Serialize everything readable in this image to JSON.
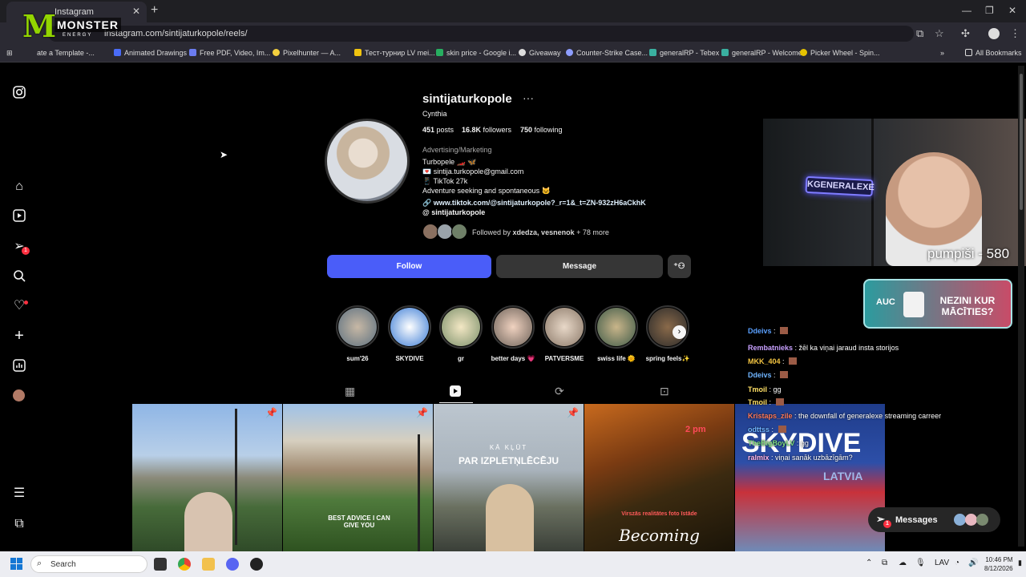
{
  "browser": {
    "tab_title": "Instagram",
    "url": "instagram.com/sintijaturkopole/reels/",
    "bookmarks": [
      "ate a Template -...",
      "Animated Drawings",
      "Free PDF, Video, Im...",
      "Pixelhunter — A...",
      "Тест-турнир LV mei...",
      "skin price - Google i...",
      "Giveaway",
      "Counter-Strike Case...",
      "generalRP - Tebex",
      "generalRP - Welcome",
      "Picker Wheel - Spin..."
    ],
    "all_bookmarks": "All Bookmarks"
  },
  "overlay": {
    "monster_word": "MONSTER",
    "monster_sub": "ENERGY",
    "neon_sign": "KGENERALEXE",
    "webcam_text": "pumpiši - 580",
    "promo_left": "AUC",
    "promo_right": "NEZINI KUR MĀCĪTIES?"
  },
  "profile": {
    "username": "sintijaturkopole",
    "display_name": "Cynthia",
    "posts_count": "451",
    "posts_label": "posts",
    "followers_count": "16.8K",
    "followers_label": "followers",
    "following_count": "750",
    "following_label": "following",
    "category": "Advertising/Marketing",
    "bio_lines": [
      "Turbopele 🏎️ 🦋",
      "💌 sintija.turkopole@gmail.com",
      "📱 TikTok 27k",
      "Adventure seeking and spontaneous 🐱"
    ],
    "link": "www.tiktok.com/@sintijaturkopole?_r=1&_t=ZN-932zH6aCkhK",
    "threads_handle": "sintijaturkopole",
    "followed_by_prefix": "Followed by",
    "followed_by_names": "xdedza, vesnenok",
    "followed_by_more": "+ 78 more",
    "follow_label": "Follow",
    "message_label": "Message"
  },
  "highlights": [
    "sum'26",
    "SKYDIVE",
    "gr",
    "better days 💗",
    "PATVERSME",
    "swiss life 🌞",
    "spring feels✨"
  ],
  "reels": {
    "reel3_small": "KĀ KĻŪT",
    "reel3_big": "PAR IZPLETŅLĒCĒJU",
    "reel2_text": "BEST ADVICE I CAN GIVE YOU",
    "reel4_top": "2 pm",
    "reel4_small": "Virszās realitātes foto īstāde",
    "reel4_big": "Becoming",
    "reel5_big": "SKYDIVE",
    "reel5_sub": "LATVIA"
  },
  "chat": [
    {
      "user": "Ddeivs",
      "text": ""
    },
    {
      "user": "Rembatnieks",
      "text": "žēl ka viņai jaraud insta storijos"
    },
    {
      "user": "MKK_404",
      "text": ""
    },
    {
      "user": "Ddeivs",
      "text": ""
    },
    {
      "user": "Tmoil",
      "text": "gg"
    },
    {
      "user": "Tmoil",
      "text": ""
    },
    {
      "user": "Kristaps_zile",
      "text": "the downfall of generalexe streaming carreer"
    },
    {
      "user": "odttss",
      "text": ""
    },
    {
      "user": "TheBigBoyLV",
      "text": "gg"
    },
    {
      "user": "ralmix",
      "text": "viņai sanāk uzbāzīgām?"
    }
  ],
  "messages_pill": {
    "label": "Messages",
    "badge": "1"
  },
  "sidebar": {
    "notification_badge": "1"
  },
  "taskbar": {
    "search_placeholder": "Search",
    "language": "LAV",
    "time": "10:46 PM",
    "date": "8/12/2026"
  },
  "colors": {
    "follow_button": "#4a5df9",
    "ig_background": "#000000",
    "badge_red": "#ff3040"
  }
}
